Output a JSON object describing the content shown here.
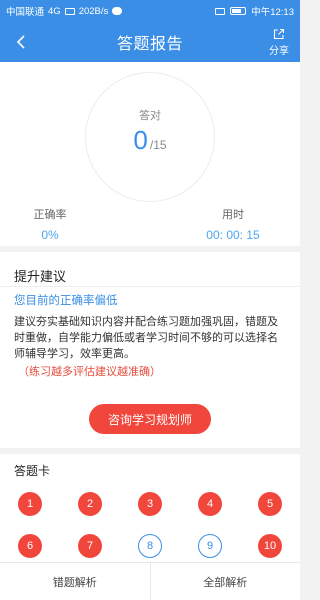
{
  "status_bar": {
    "carrier": "中国联通",
    "network": "4G",
    "speed": "202B/s",
    "time": "中午12:13"
  },
  "header": {
    "title": "答题报告",
    "share_label": "分享",
    "back_icon": "chevron-left-icon",
    "share_icon": "share-icon"
  },
  "score": {
    "label": "答对",
    "correct": "0",
    "total": "/15"
  },
  "stats": {
    "accuracy_label": "正确率",
    "accuracy_value": "0%",
    "time_label": "用时",
    "time_value": "00: 00: 15"
  },
  "suggestion": {
    "title": "提升建议",
    "status_text": "您目前的正确率偏低",
    "body": "建议夯实基础知识内容并配合练习题加强巩固，错题及时重做，自学能力偏低或者学习时间不够的可以选择名师辅导学习，效率更高。",
    "note": "（练习越多评估建议越准确）",
    "consult_button": "咨询学习规划师"
  },
  "answer_card": {
    "title": "答题卡",
    "items": [
      {
        "label": "1",
        "state": "wrong"
      },
      {
        "label": "2",
        "state": "wrong"
      },
      {
        "label": "3",
        "state": "wrong"
      },
      {
        "label": "4",
        "state": "wrong"
      },
      {
        "label": "5",
        "state": "wrong"
      },
      {
        "label": "6",
        "state": "wrong"
      },
      {
        "label": "7",
        "state": "wrong"
      },
      {
        "label": "8",
        "state": "unanswered"
      },
      {
        "label": "9",
        "state": "unanswered"
      },
      {
        "label": "10",
        "state": "wrong"
      }
    ]
  },
  "bottom_bar": {
    "wrong_analysis": "错题解析",
    "all_analysis": "全部解析"
  },
  "colors": {
    "primary": "#3a8ee6",
    "wrong": "#f1463c",
    "accent_text": "#4aa6f0"
  }
}
